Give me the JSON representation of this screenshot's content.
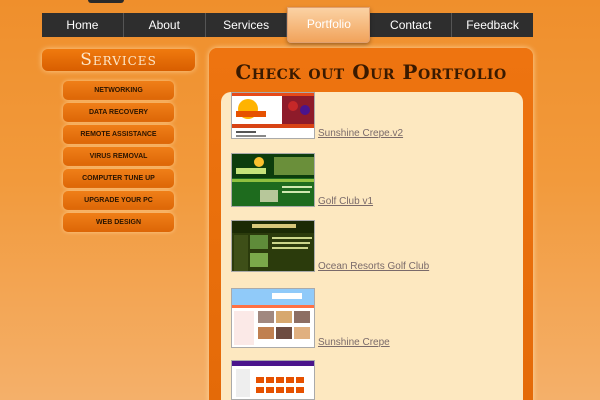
{
  "nav": {
    "items": [
      "Home",
      "About",
      "Services",
      "Portfolio",
      "Contact",
      "Feedback"
    ],
    "active": "Portfolio"
  },
  "sidebar": {
    "title": "Services",
    "items": [
      "NETWORKING",
      "DATA RECOVERY",
      "REMOTE ASSISTANCE",
      "VIRUS REMOVAL",
      "COMPUTER TUNE UP",
      "UPGRADE YOUR PC",
      "WEB DESIGN"
    ]
  },
  "main": {
    "title": "Check out Our Portfolio",
    "portfolio": [
      {
        "label": "Sunshine Crepe.v2"
      },
      {
        "label": "Golf Club v1"
      },
      {
        "label": "Ocean Resorts Golf Club"
      },
      {
        "label": "Sunshine Crepe"
      },
      {
        "label": ""
      }
    ]
  },
  "colors": {
    "background": "#ef8f2c",
    "nav_bg": "#2e2e2e",
    "panel": "#ee7410",
    "inner_panel": "#fde8c0",
    "link": "#7a6a6a"
  }
}
